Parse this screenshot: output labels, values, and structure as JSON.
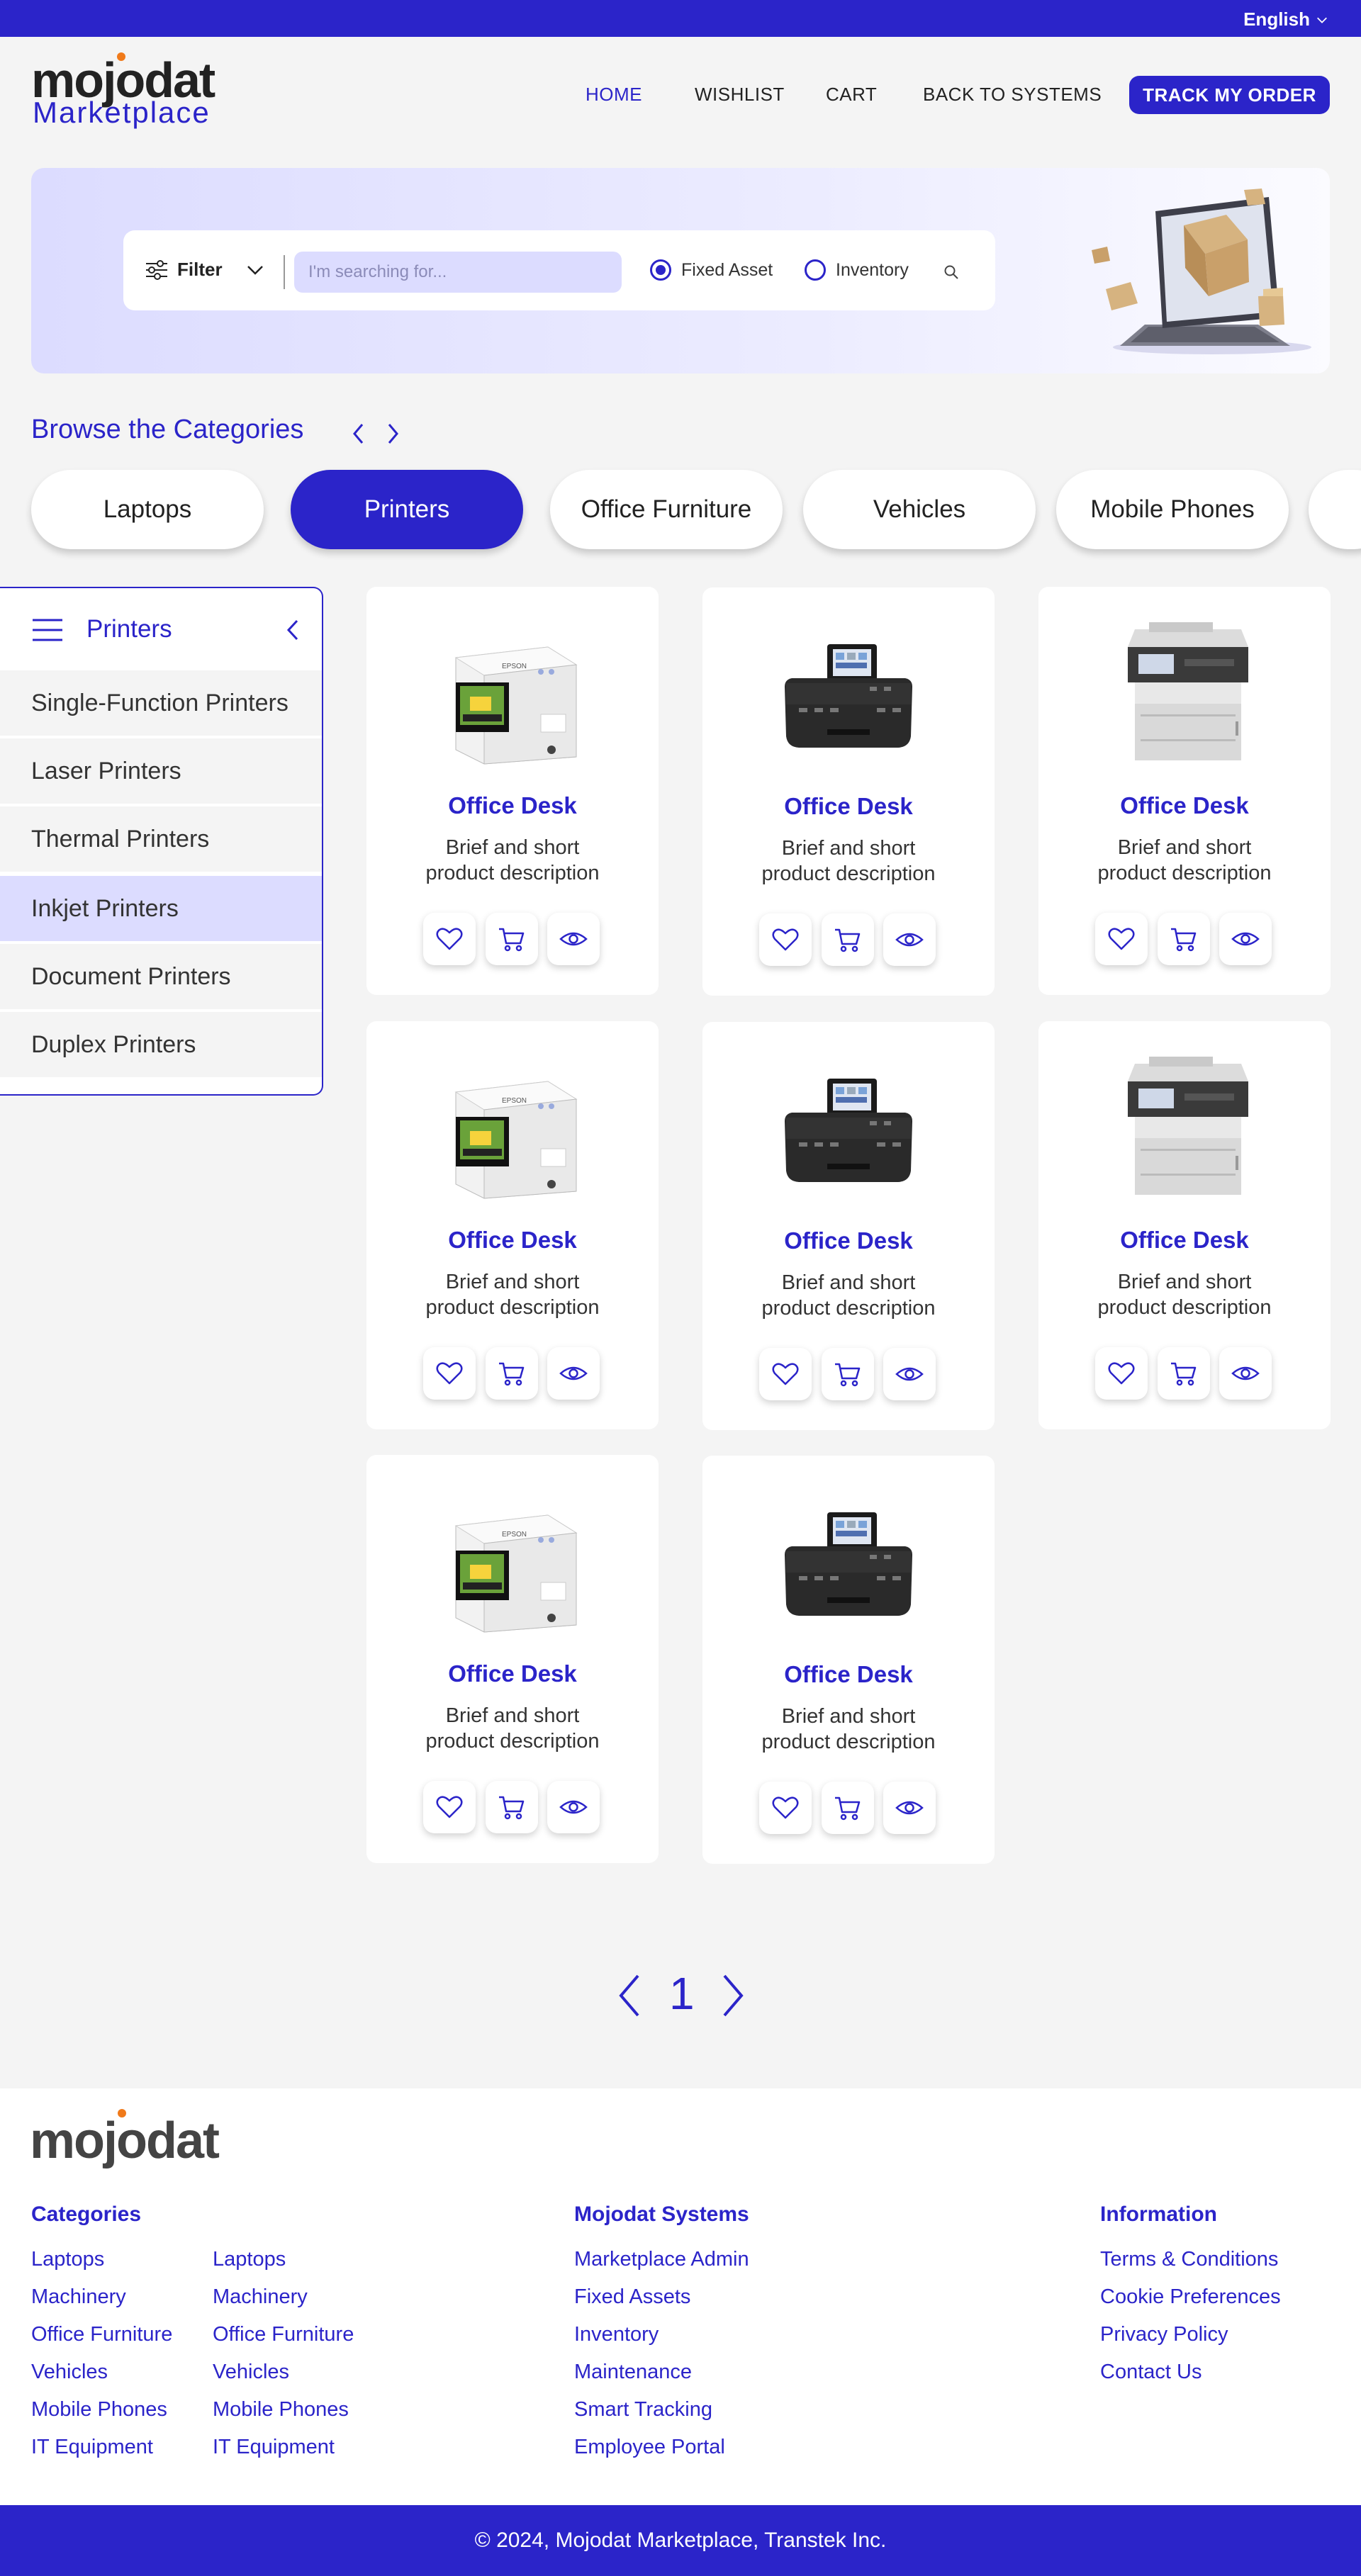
{
  "topbar": {
    "language": "English"
  },
  "brand": {
    "name": "mojodat",
    "sub": "Marketplace",
    "accent": "#2b24c9",
    "dot_color": "#f07a1a"
  },
  "nav": {
    "home": "HOME",
    "wishlist": "WISHLIST",
    "cart": "CART",
    "back": "BACK TO SYSTEMS",
    "track": "TRACK MY ORDER"
  },
  "search": {
    "filter_label": "Filter",
    "placeholder": "I'm searching for...",
    "options": [
      "Fixed Asset",
      "Inventory"
    ],
    "selected": "Fixed Asset"
  },
  "categories": {
    "title": "Browse the Categories",
    "pills": [
      "Laptops",
      "Printers",
      "Office Furniture",
      "Vehicles",
      "Mobile Phones"
    ],
    "active": "Printers"
  },
  "sidebar": {
    "title": "Printers",
    "items": [
      "Single-Function Printers",
      "Laser Printers",
      "Thermal Printers",
      "Inkjet Printers",
      "Document Printers",
      "Duplex Printers"
    ],
    "active": "Inkjet Printers"
  },
  "products": [
    {
      "name": "Office Desk",
      "desc": "Brief and short\nproduct description",
      "kind": "label-printer"
    },
    {
      "name": "Office Desk",
      "desc": "Brief and short\nproduct description",
      "kind": "photo-printer"
    },
    {
      "name": "Office Desk",
      "desc": "Brief and short\nproduct description",
      "kind": "laser-mfp"
    },
    {
      "name": "Office Desk",
      "desc": "Brief and short\nproduct description",
      "kind": "label-printer"
    },
    {
      "name": "Office Desk",
      "desc": "Brief and short\nproduct description",
      "kind": "photo-printer"
    },
    {
      "name": "Office Desk",
      "desc": "Brief and short\nproduct description",
      "kind": "laser-mfp"
    },
    {
      "name": "Office Desk",
      "desc": "Brief and short\nproduct description",
      "kind": "label-printer"
    },
    {
      "name": "Office Desk",
      "desc": "Brief and short\nproduct description",
      "kind": "photo-printer"
    }
  ],
  "product_actions": [
    "heart-icon",
    "cart-icon",
    "eye-icon"
  ],
  "pagination": {
    "current": "1"
  },
  "footer": {
    "logo": "mojodat",
    "categories_title": "Categories",
    "categories_col1": [
      "Laptops",
      "Machinery",
      "Office Furniture",
      "Vehicles",
      "Mobile Phones",
      "IT Equipment"
    ],
    "categories_col2": [
      "Laptops",
      "Machinery",
      "Office Furniture",
      "Vehicles",
      "Mobile Phones",
      "IT Equipment"
    ],
    "systems_title": "Mojodat Systems",
    "systems": [
      "Marketplace Admin",
      "Fixed Assets",
      "Inventory",
      "Maintenance",
      "Smart Tracking",
      "Employee Portal"
    ],
    "info_title": "Information",
    "info": [
      "Terms & Conditions",
      "Cookie Preferences",
      "Privacy Policy",
      "Contact Us"
    ],
    "copyright": "© 2024, Mojodat Marketplace, Transtek Inc."
  }
}
